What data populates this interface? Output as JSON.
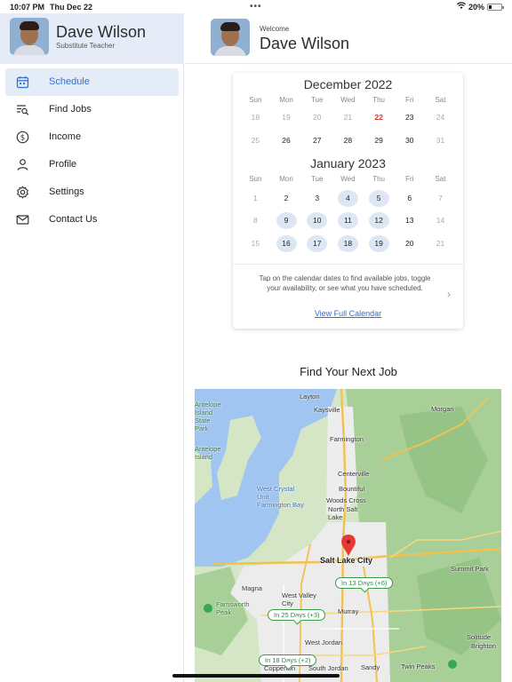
{
  "status_bar": {
    "time": "10:07 PM",
    "date": "Thu Dec 22",
    "battery": "20%"
  },
  "sidebar": {
    "profile": {
      "name": "Dave Wilson",
      "role": "Substitute Teacher"
    },
    "items": [
      {
        "label": "Schedule",
        "icon": "calendar-icon",
        "active": true
      },
      {
        "label": "Find Jobs",
        "icon": "search-list-icon",
        "active": false
      },
      {
        "label": "Income",
        "icon": "dollar-icon",
        "active": false
      },
      {
        "label": "Profile",
        "icon": "person-icon",
        "active": false
      },
      {
        "label": "Settings",
        "icon": "gear-icon",
        "active": false
      },
      {
        "label": "Contact Us",
        "icon": "mail-icon",
        "active": false
      }
    ]
  },
  "header": {
    "welcome": "Welcome",
    "name": "Dave Wilson"
  },
  "calendar": {
    "weekdays": [
      "Sun",
      "Mon",
      "Tue",
      "Wed",
      "Thu",
      "Fri",
      "Sat"
    ],
    "months": [
      {
        "title": "December 2022",
        "weeks": [
          [
            {
              "d": "18",
              "s": "weekend"
            },
            {
              "d": "19",
              "s": "past"
            },
            {
              "d": "20",
              "s": "past"
            },
            {
              "d": "21",
              "s": "past"
            },
            {
              "d": "22",
              "s": "today"
            },
            {
              "d": "23",
              "s": ""
            },
            {
              "d": "24",
              "s": "weekend"
            }
          ],
          [
            {
              "d": "25",
              "s": "weekend"
            },
            {
              "d": "26",
              "s": ""
            },
            {
              "d": "27",
              "s": ""
            },
            {
              "d": "28",
              "s": ""
            },
            {
              "d": "29",
              "s": ""
            },
            {
              "d": "30",
              "s": ""
            },
            {
              "d": "31",
              "s": "weekend"
            }
          ]
        ]
      },
      {
        "title": "January 2023",
        "weeks": [
          [
            {
              "d": "1",
              "s": "weekend"
            },
            {
              "d": "2",
              "s": ""
            },
            {
              "d": "3",
              "s": ""
            },
            {
              "d": "4",
              "s": "avail"
            },
            {
              "d": "5",
              "s": "avail"
            },
            {
              "d": "6",
              "s": ""
            },
            {
              "d": "7",
              "s": "weekend"
            }
          ],
          [
            {
              "d": "8",
              "s": "weekend"
            },
            {
              "d": "9",
              "s": "avail"
            },
            {
              "d": "10",
              "s": "avail"
            },
            {
              "d": "11",
              "s": "avail"
            },
            {
              "d": "12",
              "s": "avail"
            },
            {
              "d": "13",
              "s": ""
            },
            {
              "d": "14",
              "s": "weekend"
            }
          ],
          [
            {
              "d": "15",
              "s": "weekend"
            },
            {
              "d": "16",
              "s": "avail"
            },
            {
              "d": "17",
              "s": "avail"
            },
            {
              "d": "18",
              "s": "avail"
            },
            {
              "d": "19",
              "s": "avail"
            },
            {
              "d": "20",
              "s": ""
            },
            {
              "d": "21",
              "s": "weekend"
            }
          ]
        ]
      }
    ],
    "info": "Tap on the calendar dates to find available jobs, toggle your availability, or see what you have scheduled.",
    "link": "View Full Calendar"
  },
  "find_jobs": {
    "title": "Find Your Next Job",
    "map": {
      "places": [
        "Layton",
        "Kaysville",
        "Morgan",
        "Farmington",
        "Centerville",
        "Bountiful",
        "Woods Cross",
        "North Salt Lake",
        "Salt Lake City",
        "Summit Park",
        "Magna",
        "West Valley City",
        "Murray",
        "Solitude",
        "Brighton",
        "West Jordan",
        "Copperton",
        "South Jordan",
        "Sandy",
        "Twin Peaks",
        "Farnsworth Peak",
        "Antelope Island",
        "Antelope Island State Park"
      ],
      "water": [
        "West Crystal Unit",
        "Farmington Bay"
      ],
      "jobs": [
        {
          "label": "In 13 Days (+6)"
        },
        {
          "label": "In 25 Days (+3)"
        },
        {
          "label": "In 18 Days (+2)"
        }
      ],
      "road_shields": [
        "84",
        "89",
        "15",
        "215",
        "80",
        "154",
        "201",
        "65",
        "85",
        "80",
        "215"
      ]
    }
  }
}
